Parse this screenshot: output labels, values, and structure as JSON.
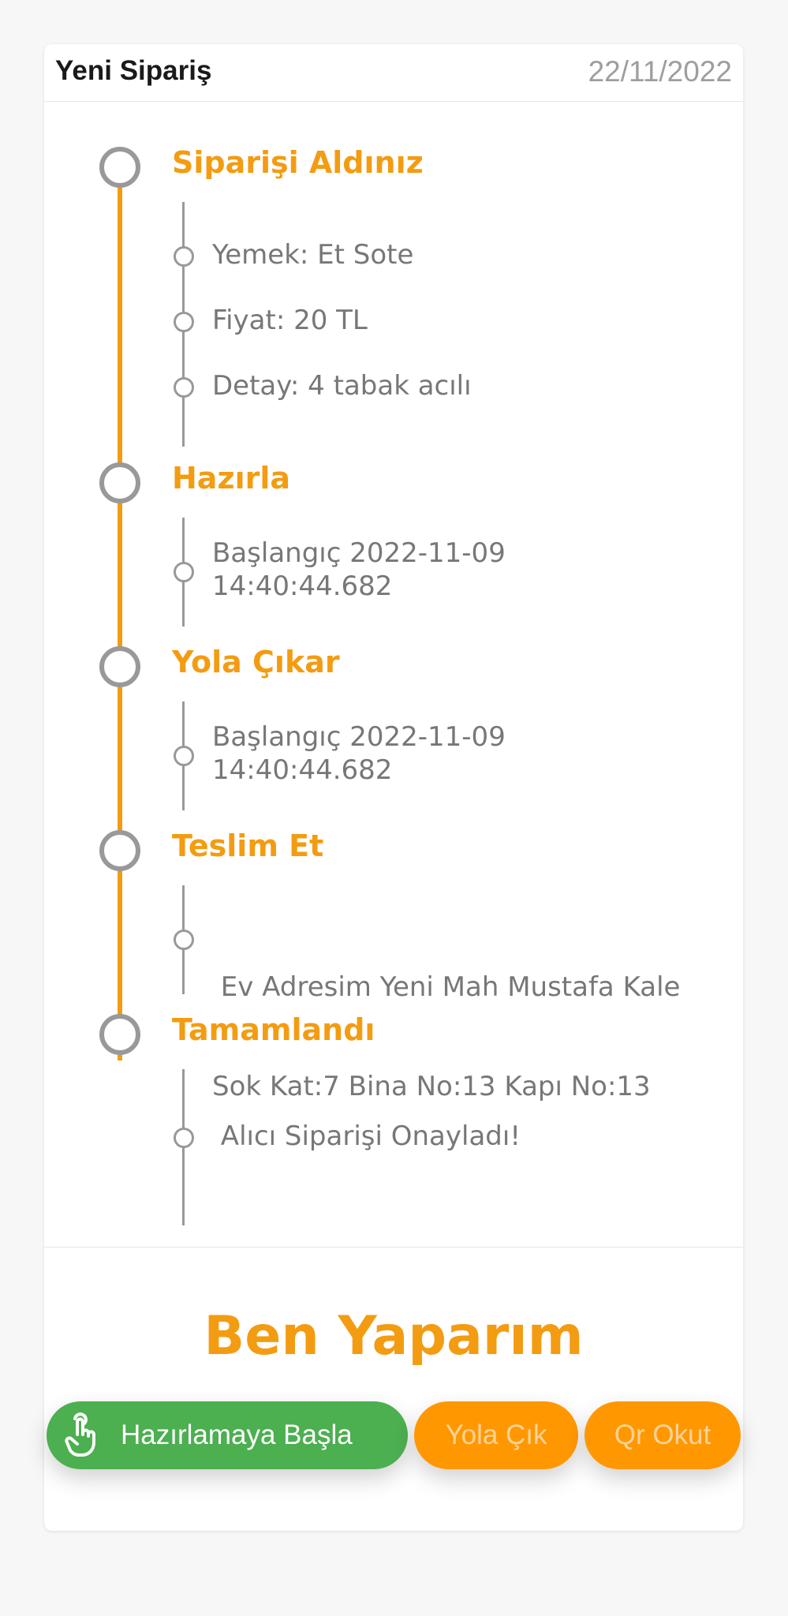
{
  "header": {
    "title": "Yeni Sipariş",
    "date": "22/11/2022"
  },
  "timeline": [
    {
      "title": "Siparişi Aldınız",
      "items": [
        "Yemek: Et Sote",
        "Fiyat: 20 TL",
        "Detay: 4 tabak acılı"
      ]
    },
    {
      "title": "Hazırla",
      "items": [
        [
          "Başlangıç 2022-11-09",
          "14:40:44.682"
        ]
      ]
    },
    {
      "title": "Yola Çıkar",
      "items": [
        [
          "Başlangıç 2022-11-09",
          "14:40:44.682"
        ]
      ]
    },
    {
      "title": "Teslim Et",
      "items": [
        [
          " Ev Adresim Yeni Mah Mustafa Kale",
          "Sok Kat:7 Bina No:13 Kapı No:13"
        ]
      ]
    },
    {
      "title": "Tamamlandı",
      "items": [
        " Alıcı Siparişi Onayladı!"
      ]
    }
  ],
  "footer": {
    "title": "Ben Yaparım"
  },
  "actions": {
    "start_prep": "Hazırlamaya Başla",
    "start_prep_icon": "hand-tap-icon",
    "go": "Yola Çık",
    "qr": "Qr Okut"
  },
  "colors": {
    "accent": "#f39c12",
    "green": "#4caf50",
    "orange_button": "#ff9800"
  }
}
